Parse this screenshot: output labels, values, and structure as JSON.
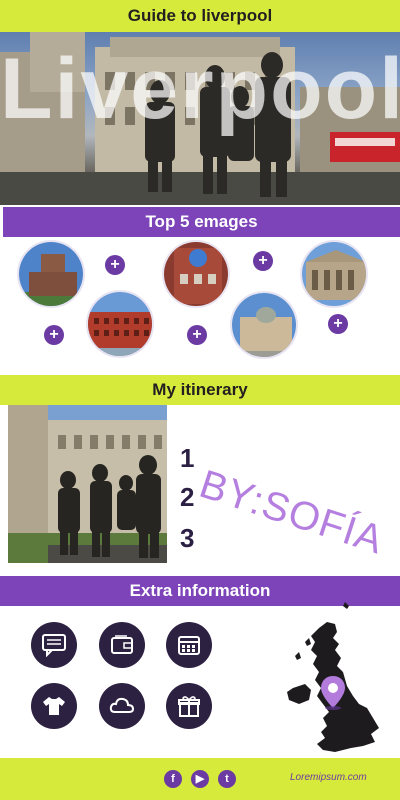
{
  "header": {
    "title": "Guide to liverpool"
  },
  "hero": {
    "title": "Liverpool"
  },
  "top_images": {
    "title": "Top 5 emages",
    "items": [
      {
        "name": "cathedral-photo"
      },
      {
        "name": "red-brick-building-photo"
      },
      {
        "name": "cavern-club-photo"
      },
      {
        "name": "port-buildings-photo"
      },
      {
        "name": "library-photo"
      }
    ],
    "plus": "+"
  },
  "itinerary": {
    "title": "My itinerary",
    "numbers": [
      "1",
      "2",
      "3"
    ],
    "author": "BY:SOFÍA"
  },
  "extra": {
    "title": "Extra information",
    "icons": [
      "chat-icon",
      "wallet-icon",
      "calendar-icon",
      "tshirt-icon",
      "cloud-icon",
      "gift-icon"
    ]
  },
  "footer": {
    "social": [
      "f",
      "▶",
      "t"
    ],
    "site": "Loremipsum.com"
  },
  "colors": {
    "lime": "#d6ea3b",
    "purple": "#7d44b9",
    "dark": "#2d2142"
  }
}
